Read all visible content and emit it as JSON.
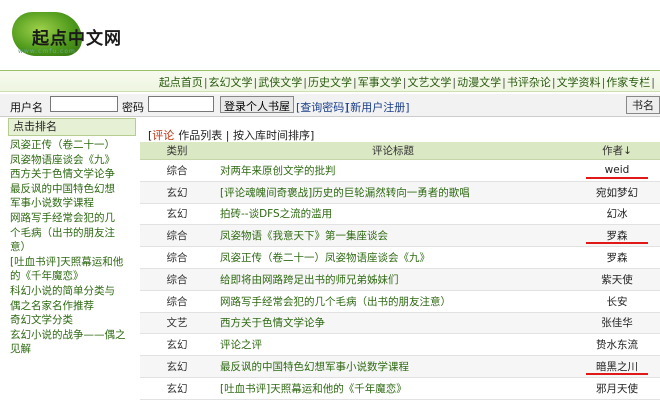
{
  "logo": {
    "text": "起点中文网",
    "url": "www.cmfu.com"
  },
  "nav": [
    "起点首页",
    "玄幻文学",
    "武侠文学",
    "历史文学",
    "军事文学",
    "文艺文学",
    "动漫文学",
    "书评杂论",
    "文学资料",
    "作家专栏"
  ],
  "login": {
    "user_label": "用户名",
    "password_label": "密码",
    "submit_label": "登录个人书屋",
    "link_query": "[查询密码]",
    "link_register": "[新用户注册]",
    "right_button": "书名"
  },
  "sidebar": {
    "title": "点击排名",
    "items": [
      "凤姿正传（卷二十一）",
      "凤姿物语座谈会《九》",
      "西方关于色情文学论争",
      "最反讽的中国特色幻想",
      "军事小说数学课程",
      "网路写手经常会犯的几",
      "个毛病（出书的朋友注",
      "意）",
      "[吐血书评]天照幕运和他",
      "的《千年魔恋》",
      "科幻小说的简单分类与",
      "偶之名家名作推荐",
      "奇幻文学分类",
      "玄幻小说的战争——偶之",
      "见解"
    ]
  },
  "tabs": {
    "review": "评论",
    "list": "作品列表",
    "sort": "按入库时间排序"
  },
  "table": {
    "headers": {
      "category": "类别",
      "title": "评论标题",
      "author": "作者↓"
    },
    "rows": [
      {
        "category": "综合",
        "title": "对两年来原创文学的批判",
        "author": "weid",
        "underline": true
      },
      {
        "category": "玄幻",
        "title": "[评论魂魄间奇褒战]历史的巨轮漏然转向一勇者的歌唱",
        "author": "宛如梦幻",
        "underline": false
      },
      {
        "category": "玄幻",
        "title": "拍砖--谈DFS之流的滥用",
        "author": "幻冰",
        "underline": false
      },
      {
        "category": "综合",
        "title": "凤姿物语《我意天下》第一集座谈会",
        "author": "罗森",
        "underline": true
      },
      {
        "category": "综合",
        "title": "凤姿正传（卷二十一）凤姿物语座谈会《九》",
        "author": "罗森",
        "underline": false
      },
      {
        "category": "综合",
        "title": "给即将由网路跨足出书的师兄弟姊妹们",
        "author": "紫天使",
        "underline": false
      },
      {
        "category": "综合",
        "title": "网路写手经常会犯的几个毛病（出书的朋友注意）",
        "author": "长安",
        "underline": false
      },
      {
        "category": "文艺",
        "title": "西方关于色情文学论争",
        "author": "张佳华",
        "underline": false
      },
      {
        "category": "玄幻",
        "title": "评论之评",
        "author": "贽水东流",
        "underline": false
      },
      {
        "category": "玄幻",
        "title": "最反讽的中国特色幻想军事小说数学课程",
        "author": "暗黑之川",
        "underline": true
      },
      {
        "category": "玄幻",
        "title": "[吐血书评]天照幕运和他的《千年魔恋》",
        "author": "邪月天使",
        "underline": false
      }
    ]
  }
}
